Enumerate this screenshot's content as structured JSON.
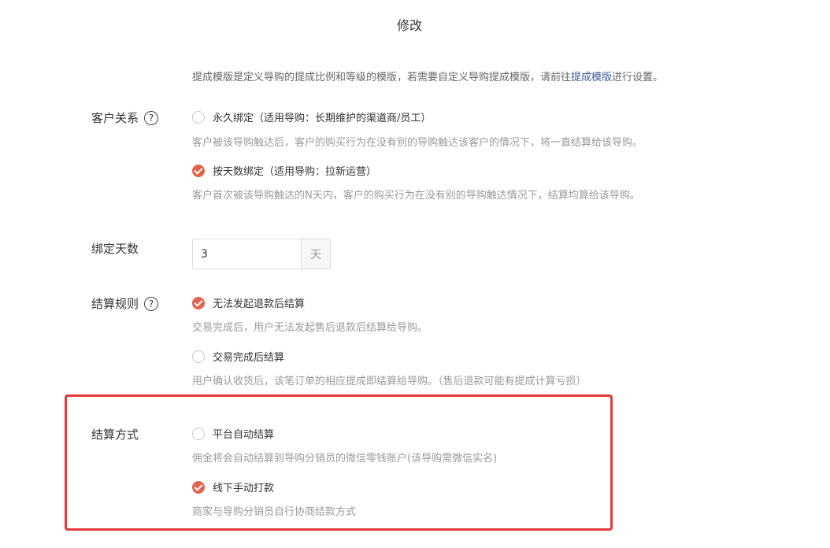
{
  "page_title": "修改",
  "intro": {
    "text_before": "提成模版是定义导购的提成比例和等级的模版，若需要自定义导购提成模版，请前往",
    "link": "提成模版",
    "text_after": "进行设置。"
  },
  "customer_relation": {
    "label": "客户关系",
    "help_icon_glyph": "?",
    "options": [
      {
        "label": "永久绑定（适用导购：长期维护的渠道商/员工）",
        "desc": "客户被该导购触达后，客户的购买行为在没有别的导购触达该客户的情况下，将一直结算给该导购。",
        "checked": false
      },
      {
        "label": "按天数绑定（适用导购：拉新运营）",
        "desc": "客户首次被该导购触达的N天内，客户的购买行为在没有别的导购触达情况下，结算均算给该导购。",
        "checked": true
      }
    ]
  },
  "bind_days": {
    "label": "绑定天数",
    "value": "3",
    "unit": "天"
  },
  "settlement_rule": {
    "label": "结算规则",
    "help_icon_glyph": "?",
    "options": [
      {
        "label": "无法发起退款后结算",
        "desc": "交易完成后，用户无法发起售后退款后结算给导购。",
        "checked": true
      },
      {
        "label": "交易完成后结算",
        "desc": "用户确认收货后，该笔订单的相应提成即结算给导购。（售后退款可能有提成计算亏损）",
        "checked": false
      }
    ]
  },
  "settlement_method": {
    "label": "结算方式",
    "options": [
      {
        "label": "平台自动结算",
        "desc": "佣金将会自动结算到导购分销员的微信零钱账户(该导购需微信实名)",
        "checked": false
      },
      {
        "label": "线下手动打款",
        "desc": "商家与导购分销员自行协商结款方式",
        "checked": true
      }
    ]
  },
  "colors": {
    "accent": "#e5624b",
    "highlight_border": "#e23a36",
    "link": "#3a5a9a"
  }
}
